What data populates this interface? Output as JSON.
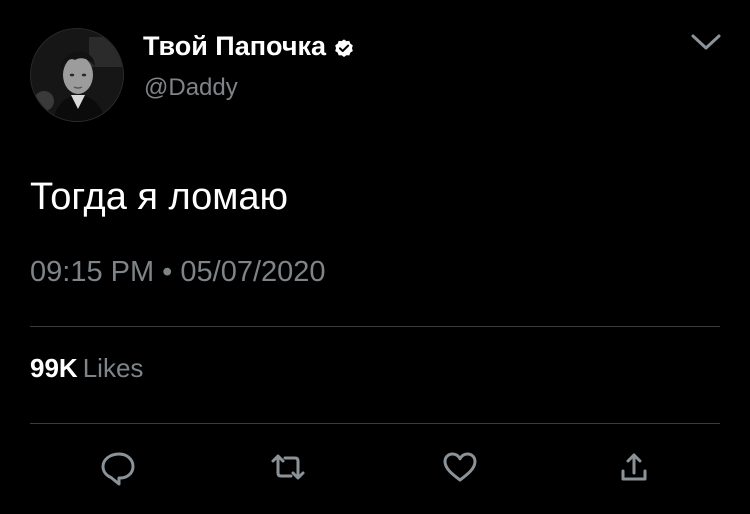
{
  "user": {
    "display_name": "Твой Папочка",
    "handle": "@Daddy",
    "verified": true
  },
  "tweet": {
    "text": "Тогда я ломаю",
    "timestamp": "09:15 PM • 05/07/2020"
  },
  "stats": {
    "likes_count": "99K",
    "likes_label": "Likes"
  },
  "icons": {
    "menu": "chevron-down-icon",
    "verified": "verified-badge-icon",
    "actions": [
      "reply-icon",
      "retweet-icon",
      "like-icon",
      "share-icon"
    ]
  },
  "colors": {
    "background": "#000000",
    "primary_text": "#ffffff",
    "secondary_text": "#7e8487",
    "divider": "#3a3e41",
    "icon": "#8b9399"
  }
}
